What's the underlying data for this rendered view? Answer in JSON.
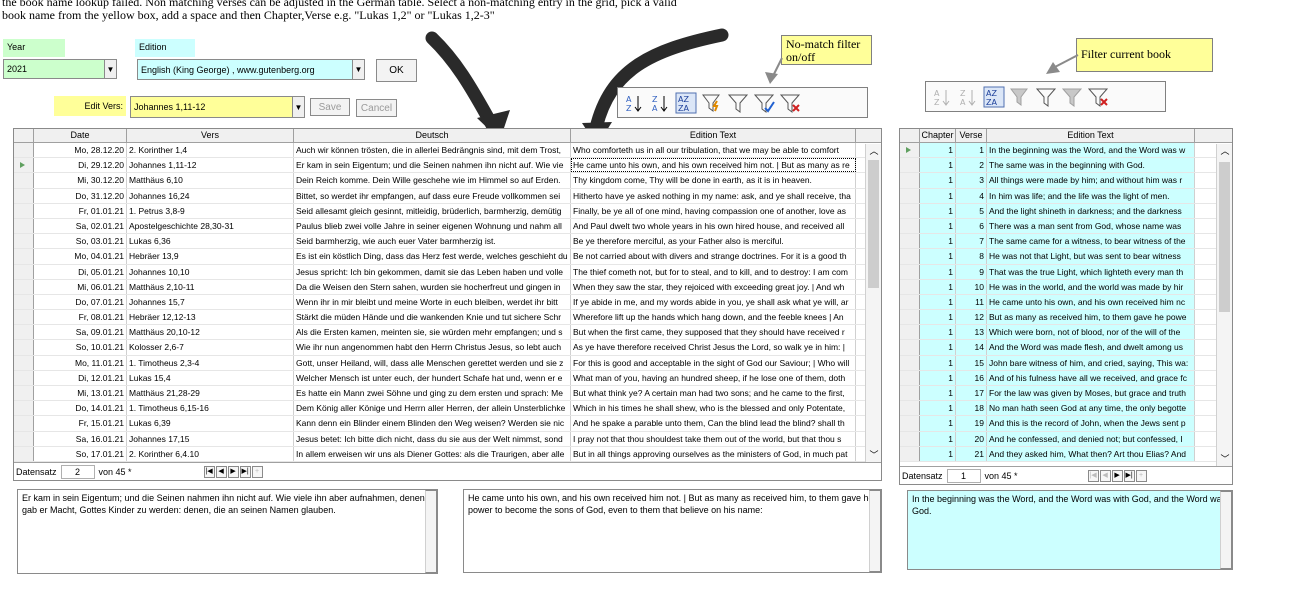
{
  "instructions": {
    "line1": "the book name lookup failed. Non matching verses can be adjusted in the German table. Select a non-matching entry in the grid, pick a valid",
    "line2": "book name from the yellow box, add  a space and then Chapter,Verse e.g. \"Lukas 1,2\" or \"Lukas 1,2-3\""
  },
  "year": {
    "label": "Year",
    "value": "2021"
  },
  "edition": {
    "label": "Edition",
    "value": "English (King George) , www.gutenberg.org"
  },
  "ok_label": "OK",
  "edit_vers": {
    "label": "Edit Vers:",
    "value": "Johannes 1,11-12",
    "save_label": "Save",
    "cancel_label": "Cancel"
  },
  "notes": {
    "nomatch": "No-match filter on/off",
    "filter_book": "Filter current book"
  },
  "main_grid": {
    "headers": [
      "Date",
      "Vers",
      "Deutsch",
      "Edition Text"
    ],
    "rows": [
      [
        "Mo, 28.12.20",
        "2. Korinther 1,4",
        "Auch wir können trösten, die in allerlei Bedrängnis sind, mit dem Trost,",
        "Who comforteth us in all our tribulation, that we may be able to comfort"
      ],
      [
        "Di, 29.12.20",
        "Johannes 1,11-12",
        "Er kam in sein Eigentum; und die Seinen nahmen ihn nicht auf. Wie vie",
        "He came unto his own, and his own received him not. | But as many as re"
      ],
      [
        "Mi, 30.12.20",
        "Matthäus 6,10",
        "Dein Reich komme. Dein Wille geschehe wie im Himmel so auf Erden.",
        "Thy kingdom come, Thy will be done in earth, as it is in heaven."
      ],
      [
        "Do, 31.12.20",
        "Johannes 16,24",
        "Bittet, so werdet ihr empfangen, auf dass eure Freude vollkommen sei",
        "Hitherto have ye asked nothing in my name: ask, and ye shall receive, tha"
      ],
      [
        "Fr, 01.01.21",
        "1. Petrus 3,8-9",
        "Seid allesamt gleich gesinnt, mitleidig, brüderlich, barmherzig, demütig",
        "Finally, be ye all of one mind, having compassion one of another, love as"
      ],
      [
        "Sa, 02.01.21",
        "Apostelgeschichte 28,30-31",
        "Paulus blieb zwei volle Jahre in seiner eigenen Wohnung und nahm all",
        "And Paul dwelt two whole years in his own hired house, and received all"
      ],
      [
        "So, 03.01.21",
        "Lukas 6,36",
        "Seid barmherzig, wie auch euer Vater barmherzig ist.",
        "Be ye therefore merciful, as your Father also is merciful."
      ],
      [
        "Mo, 04.01.21",
        "Hebräer 13,9",
        "Es ist ein köstlich Ding, dass das Herz fest werde, welches geschieht du",
        "Be not carried about with divers and strange doctrines. For it is a good th"
      ],
      [
        "Di, 05.01.21",
        "Johannes 10,10",
        " Jesus spricht: Ich bin gekommen, damit sie das Leben haben und volle",
        "The thief cometh not, but for to steal, and to kill, and to destroy: I am com"
      ],
      [
        "Mi, 06.01.21",
        "Matthäus 2,10-11",
        "Da die Weisen den Stern sahen, wurden sie hocherfreut und gingen in",
        "When they saw the star, they rejoiced with exceeding great joy. | And wh"
      ],
      [
        "Do, 07.01.21",
        "Johannes 15,7",
        "Wenn ihr in mir bleibt und meine Worte in euch bleiben, werdet ihr bitt",
        "If ye abide in me, and my words abide in you, ye shall ask what ye will, ar"
      ],
      [
        "Fr, 08.01.21",
        "Hebräer 12,12-13",
        "Stärkt die müden Hände und die wankenden Knie und tut sichere Schr",
        "Wherefore lift up the hands which hang down, and the feeble knees | An"
      ],
      [
        "Sa, 09.01.21",
        "Matthäus 20,10-12",
        "Als die Ersten kamen, meinten sie, sie würden mehr empfangen; und s",
        "But when the first came, they supposed that they should have received r"
      ],
      [
        "So, 10.01.21",
        "Kolosser 2,6-7",
        "Wie ihr nun angenommen habt den Herrn Christus Jesus, so lebt auch",
        " As ye have therefore received Christ Jesus the Lord, so walk ye in him: |"
      ],
      [
        "Mo, 11.01.21",
        "1. Timotheus 2,3-4",
        "Gott, unser Heiland, will, dass alle Menschen gerettet werden und sie z",
        "For this is good and acceptable in the sight of God our Saviour; | Who will"
      ],
      [
        "Di, 12.01.21",
        "Lukas 15,4",
        "Welcher Mensch ist unter euch, der hundert Schafe hat und, wenn er e",
        "What man of you, having an hundred sheep, if he lose one of them, doth"
      ],
      [
        "Mi, 13.01.21",
        "Matthäus 21,28-29",
        "Es hatte ein Mann zwei Söhne und ging zu dem ersten und sprach: Me",
        "But what think ye? A certain man had two sons; and he came to the first,"
      ],
      [
        "Do, 14.01.21",
        "1. Timotheus 6,15-16",
        "Dem König aller Könige und Herrn aller Herren, der allein Unsterblichke",
        "Which in his times he shall shew, who is the blessed and only Potentate,"
      ],
      [
        "Fr, 15.01.21",
        "Lukas 6,39",
        "Kann denn ein Blinder einem Blinden den Weg weisen? Werden sie nic",
        "And he spake a parable unto them, Can the blind lead the blind? shall th"
      ],
      [
        "Sa, 16.01.21",
        "Johannes 17,15",
        " Jesus betet: Ich bitte dich nicht, dass du sie aus der Welt nimmst, sond",
        "I pray not that thou shouldest take them out of the world, but that thou s"
      ],
      [
        "So, 17.01.21",
        "2. Korinther 6,4.10",
        "In allem erweisen wir uns als Diener Gottes: als die Traurigen, aber alle",
        "But in all things approving ourselves as the ministers of God, in much pat"
      ]
    ],
    "nav": {
      "label": "Datensatz",
      "current": "2",
      "total": "von 45 *"
    }
  },
  "book_grid": {
    "headers": [
      "Chapter",
      "Verse",
      "Edition Text"
    ],
    "rows": [
      [
        "1",
        "1",
        "In the beginning was the Word, and the Word was w"
      ],
      [
        "1",
        "2",
        "The same was in the beginning with God."
      ],
      [
        "1",
        "3",
        "All things were made by him; and without him was r"
      ],
      [
        "1",
        "4",
        "In him was life; and the life was the light of men."
      ],
      [
        "1",
        "5",
        "And the light shineth in darkness; and the darkness"
      ],
      [
        "1",
        "6",
        "There was a man sent from God, whose name was"
      ],
      [
        "1",
        "7",
        "The same came for a witness, to bear witness of the"
      ],
      [
        "1",
        "8",
        "He was not that Light, but was sent to bear witness"
      ],
      [
        "1",
        "9",
        "That was the true Light, which lighteth every man th"
      ],
      [
        "1",
        "10",
        "He was in the world, and the world was made by hir"
      ],
      [
        "1",
        "11",
        "He came unto his own, and his own received him nc"
      ],
      [
        "1",
        "12",
        "But as many as received him, to them gave he powe"
      ],
      [
        "1",
        "13",
        "Which were born, not of blood, nor of the will of the"
      ],
      [
        "1",
        "14",
        "And the Word was made flesh, and dwelt among us"
      ],
      [
        "1",
        "15",
        "John bare witness of him, and cried, saying, This wa:"
      ],
      [
        "1",
        "16",
        "And of his fulness have all we received, and grace fc"
      ],
      [
        "1",
        "17",
        "For the law was given by Moses, but grace and truth"
      ],
      [
        "1",
        "18",
        "No man hath seen God at any time, the only begotte"
      ],
      [
        "1",
        "19",
        "And this is the record of John, when the Jews sent p"
      ],
      [
        "1",
        "20",
        "And he confessed, and denied not; but confessed, I"
      ],
      [
        "1",
        "21",
        "And they asked him, What then? Art thou Elias? And"
      ]
    ],
    "nav": {
      "label": "Datensatz",
      "current": "1",
      "total": "von 45 *"
    }
  },
  "memos": {
    "deutsch": "Er kam in sein Eigentum; und die Seinen nahmen ihn nicht auf. Wie viele ihn aber aufnahmen, denen gab er Macht, Gottes Kinder zu werden: denen, die an seinen Namen glauben.",
    "edition": "He came unto his own, and his own received him not. | But as many as received him, to them gave he power to become the sons of God, even to them that believe on his name:",
    "book": "In the beginning was the Word, and the Word was with God, and the Word was God."
  },
  "colors": {
    "green": "#ccffcc",
    "cyan": "#ccffff",
    "yellow": "#ffff99"
  }
}
